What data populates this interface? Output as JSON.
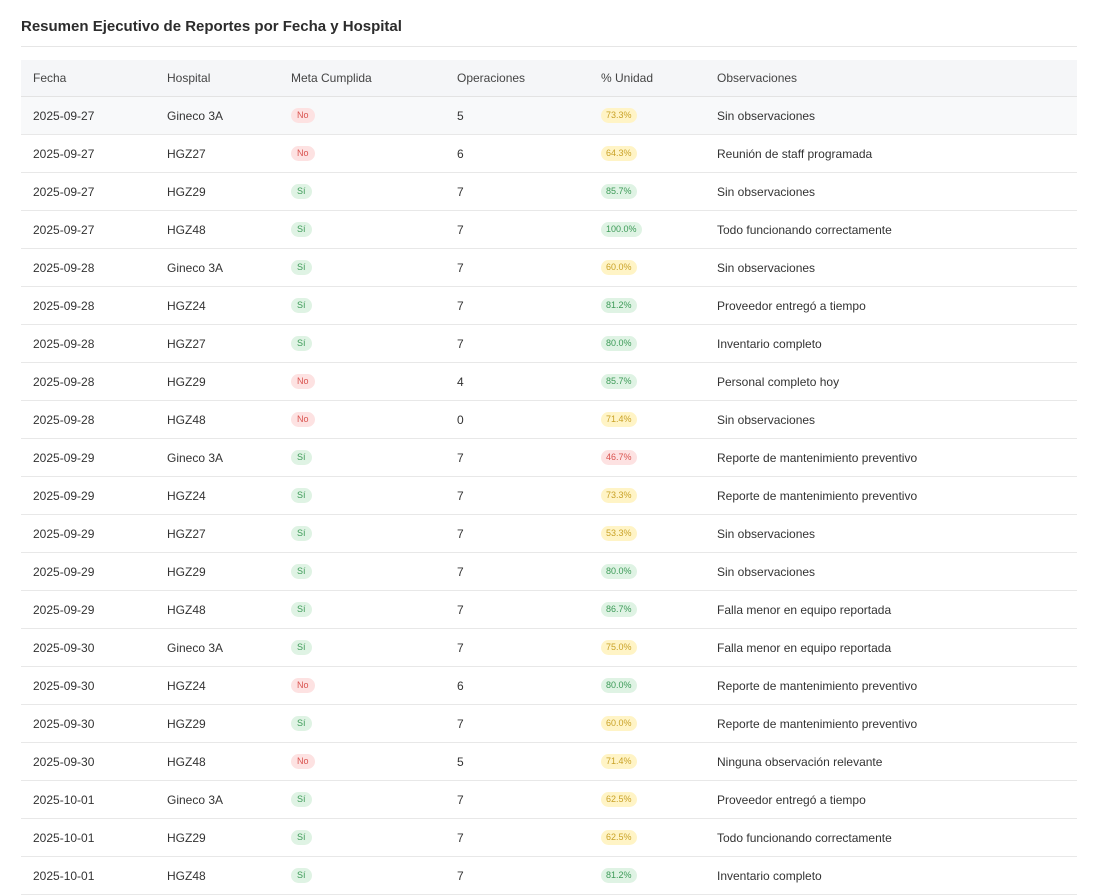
{
  "report": {
    "title": "Resumen Ejecutivo de Reportes por Fecha y Hospital"
  },
  "columns": {
    "fecha": "Fecha",
    "hospital": "Hospital",
    "meta": "Meta Cumplida",
    "operaciones": "Operaciones",
    "unidad": "% Unidad",
    "observaciones": "Observaciones"
  },
  "colors": {
    "meta_si": "#3c9a57",
    "meta_no": "#d9534f",
    "pct_high": "#3c9a57",
    "pct_mid": "#c9a227",
    "pct_low": "#d9534f"
  },
  "rows": [
    {
      "fecha": "2025-09-27",
      "hospital": "Gineco 3A",
      "meta": "No",
      "ops": "5",
      "pct": "73.3%",
      "level": "yellow",
      "obs": "Sin observaciones"
    },
    {
      "fecha": "2025-09-27",
      "hospital": "HGZ27",
      "meta": "No",
      "ops": "6",
      "pct": "64.3%",
      "level": "yellow",
      "obs": "Reunión de staff programada"
    },
    {
      "fecha": "2025-09-27",
      "hospital": "HGZ29",
      "meta": "Sí",
      "ops": "7",
      "pct": "85.7%",
      "level": "green",
      "obs": "Sin observaciones"
    },
    {
      "fecha": "2025-09-27",
      "hospital": "HGZ48",
      "meta": "Sí",
      "ops": "7",
      "pct": "100.0%",
      "level": "green",
      "obs": "Todo funcionando correctamente"
    },
    {
      "fecha": "2025-09-28",
      "hospital": "Gineco 3A",
      "meta": "Sí",
      "ops": "7",
      "pct": "60.0%",
      "level": "yellow",
      "obs": "Sin observaciones"
    },
    {
      "fecha": "2025-09-28",
      "hospital": "HGZ24",
      "meta": "Sí",
      "ops": "7",
      "pct": "81.2%",
      "level": "green",
      "obs": "Proveedor entregó a tiempo"
    },
    {
      "fecha": "2025-09-28",
      "hospital": "HGZ27",
      "meta": "Sí",
      "ops": "7",
      "pct": "80.0%",
      "level": "green",
      "obs": "Inventario completo"
    },
    {
      "fecha": "2025-09-28",
      "hospital": "HGZ29",
      "meta": "No",
      "ops": "4",
      "pct": "85.7%",
      "level": "green",
      "obs": "Personal completo hoy"
    },
    {
      "fecha": "2025-09-28",
      "hospital": "HGZ48",
      "meta": "No",
      "ops": "0",
      "pct": "71.4%",
      "level": "yellow",
      "obs": "Sin observaciones"
    },
    {
      "fecha": "2025-09-29",
      "hospital": "Gineco 3A",
      "meta": "Sí",
      "ops": "7",
      "pct": "46.7%",
      "level": "red",
      "obs": "Reporte de mantenimiento preventivo"
    },
    {
      "fecha": "2025-09-29",
      "hospital": "HGZ24",
      "meta": "Sí",
      "ops": "7",
      "pct": "73.3%",
      "level": "yellow",
      "obs": "Reporte de mantenimiento preventivo"
    },
    {
      "fecha": "2025-09-29",
      "hospital": "HGZ27",
      "meta": "Sí",
      "ops": "7",
      "pct": "53.3%",
      "level": "yellow",
      "obs": "Sin observaciones"
    },
    {
      "fecha": "2025-09-29",
      "hospital": "HGZ29",
      "meta": "Sí",
      "ops": "7",
      "pct": "80.0%",
      "level": "green",
      "obs": "Sin observaciones"
    },
    {
      "fecha": "2025-09-29",
      "hospital": "HGZ48",
      "meta": "Sí",
      "ops": "7",
      "pct": "86.7%",
      "level": "green",
      "obs": "Falla menor en equipo reportada"
    },
    {
      "fecha": "2025-09-30",
      "hospital": "Gineco 3A",
      "meta": "Sí",
      "ops": "7",
      "pct": "75.0%",
      "level": "yellow",
      "obs": "Falla menor en equipo reportada"
    },
    {
      "fecha": "2025-09-30",
      "hospital": "HGZ24",
      "meta": "No",
      "ops": "6",
      "pct": "80.0%",
      "level": "green",
      "obs": "Reporte de mantenimiento preventivo"
    },
    {
      "fecha": "2025-09-30",
      "hospital": "HGZ29",
      "meta": "Sí",
      "ops": "7",
      "pct": "60.0%",
      "level": "yellow",
      "obs": "Reporte de mantenimiento preventivo"
    },
    {
      "fecha": "2025-09-30",
      "hospital": "HGZ48",
      "meta": "No",
      "ops": "5",
      "pct": "71.4%",
      "level": "yellow",
      "obs": "Ninguna observación relevante"
    },
    {
      "fecha": "2025-10-01",
      "hospital": "Gineco 3A",
      "meta": "Sí",
      "ops": "7",
      "pct": "62.5%",
      "level": "yellow",
      "obs": "Proveedor entregó a tiempo"
    },
    {
      "fecha": "2025-10-01",
      "hospital": "HGZ29",
      "meta": "Sí",
      "ops": "7",
      "pct": "62.5%",
      "level": "yellow",
      "obs": "Todo funcionando correctamente"
    },
    {
      "fecha": "2025-10-01",
      "hospital": "HGZ48",
      "meta": "Sí",
      "ops": "7",
      "pct": "81.2%",
      "level": "green",
      "obs": "Inventario completo"
    }
  ]
}
